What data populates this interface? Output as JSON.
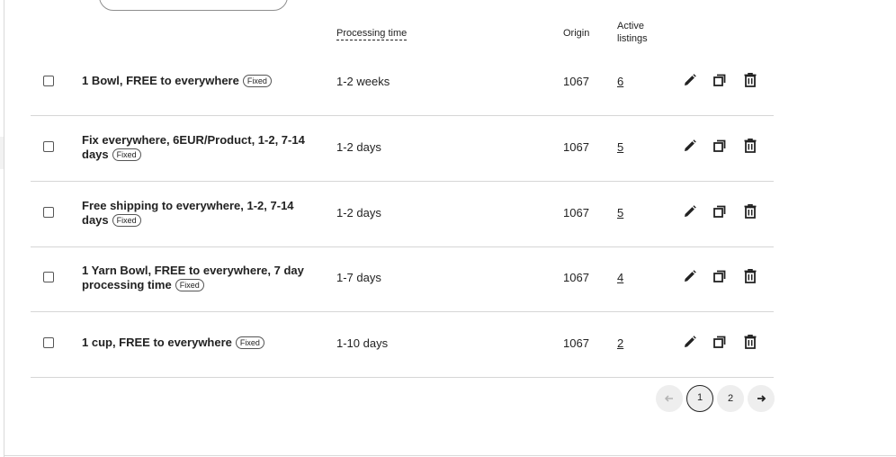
{
  "table": {
    "headers": {
      "processing_time": "Processing time",
      "origin": "Origin",
      "active_listings": "Active listings"
    },
    "rows": [
      {
        "name": "1 Bowl, FREE to everywhere",
        "badge": "Fixed",
        "processing": "1-2 weeks",
        "origin": "1067",
        "active": "6"
      },
      {
        "name": "Fix everywhere, 6EUR/Product, 1-2, 7-14 days",
        "badge": "Fixed",
        "processing": "1-2 days",
        "origin": "1067",
        "active": "5"
      },
      {
        "name": "Free shipping to everywhere, 1-2, 7-14 days",
        "badge": "Fixed",
        "processing": "1-2 days",
        "origin": "1067",
        "active": "5"
      },
      {
        "name": "1 Yarn Bowl, FREE to everywhere, 7 day processing time",
        "badge": "Fixed",
        "processing": "1-7 days",
        "origin": "1067",
        "active": "4"
      },
      {
        "name": "1 cup, FREE to everywhere",
        "badge": "Fixed",
        "processing": "1-10 days",
        "origin": "1067",
        "active": "2"
      }
    ]
  },
  "pagination": {
    "prev_icon": "arrow-left-icon",
    "pages": [
      "1",
      "2"
    ],
    "current": "1",
    "next_icon": "arrow-right-icon"
  },
  "icons": {
    "edit": "pencil-icon",
    "copy": "copy-icon",
    "delete": "trash-icon"
  }
}
